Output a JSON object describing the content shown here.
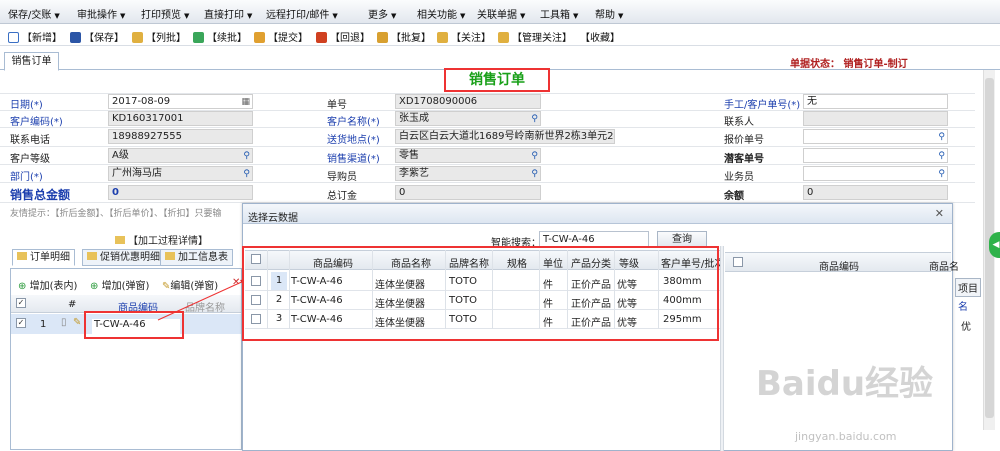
{
  "menubar": [
    {
      "label": "保存/交账"
    },
    {
      "label": "审批操作"
    },
    {
      "label": "打印预览"
    },
    {
      "label": "直接打印"
    },
    {
      "label": "远程打印/邮件"
    },
    {
      "label": "更多"
    },
    {
      "label": "相关功能"
    },
    {
      "label": "关联单据"
    },
    {
      "label": "工具箱"
    },
    {
      "label": "帮助"
    }
  ],
  "toolbar": [
    {
      "label": "【新增】",
      "icon": "new-doc-icon",
      "color": "#3a6fc4"
    },
    {
      "label": "【保存】",
      "icon": "save-icon",
      "color": "#2b55a6"
    },
    {
      "label": "【列批】",
      "icon": "check-icon",
      "color": "#e0b040"
    },
    {
      "label": "【续批】",
      "icon": "continue-icon",
      "color": "#3aa65a"
    },
    {
      "label": "【提交】",
      "icon": "submit-icon",
      "color": "#e0a030"
    },
    {
      "label": "【回退】",
      "icon": "rollback-icon",
      "color": "#d04020"
    },
    {
      "label": "【批复】",
      "icon": "reply-icon",
      "color": "#d8a030"
    },
    {
      "label": "【关注】",
      "icon": "follow-icon",
      "color": "#e0b040"
    },
    {
      "label": "【管理关注】",
      "icon": "manage-follow-icon",
      "color": "#e0b040"
    },
    {
      "label": "【收藏】",
      "icon": "",
      "color": ""
    }
  ],
  "main_tab": "销售订单",
  "status": "单据状态： 销售订单-制订",
  "form_title": "销售订单",
  "fields": {
    "date_label": "日期(*)",
    "date_value": "2017-08-09",
    "order_no_label": "单号",
    "order_no_value": "XD1708090006",
    "manual_no_label": "手工/客户单号(*)",
    "manual_no_value": "无",
    "cust_code_label": "客户编码(*)",
    "cust_code_value": "KD160317001",
    "cust_name_label": "客户名称(*)",
    "cust_name_value": "张玉成",
    "contact_label": "联系人",
    "contact_value": "",
    "phone_label": "联系电话",
    "phone_value": "18988927555",
    "address_label": "送货地点(*)",
    "address_value": "白云区白云大道北1689号岭南新世界2栋3单元2楼02之",
    "quote_label": "报价单号",
    "quote_value": "",
    "level_label": "客户等级",
    "level_value": "A级",
    "channel_label": "销售渠道(*)",
    "channel_value": "零售",
    "potential_label": "潜客单号",
    "potential_value": "",
    "dept_label": "部门(*)",
    "dept_value": "广州海马店",
    "guide_label": "导购员",
    "guide_value": "李紫艺",
    "sales_label": "业务员",
    "sales_value": "",
    "total_label": "销售总金额",
    "total_value": "0",
    "order_total_label": "总订金",
    "order_total_value": "0",
    "balance_label": "余额",
    "balance_value": "0"
  },
  "hint": "友情提示：【折后金额】、【折后单价】、【折扣】只要输",
  "process_btn": "【加工过程详情】",
  "subtabs": [
    "订单明细",
    "促销优惠明细",
    "加工信息表"
  ],
  "left_grid": {
    "buttons": [
      "增加(表内)",
      "增加(弹窗)",
      "编辑(弹窗)"
    ],
    "headers": [
      "#",
      "商品编码",
      "品牌名称"
    ],
    "row": {
      "num": "1",
      "code": "T-CW-A-46"
    }
  },
  "popup": {
    "title": "选择云数据",
    "search_label": "智能搜索：",
    "search_value": "T-CW-A-46",
    "query_btn": "查询",
    "headers": [
      "商品编码",
      "商品名称",
      "品牌名称",
      "规格",
      "单位",
      "产品分类",
      "等级",
      "客户单号/批次"
    ],
    "rows": [
      {
        "num": "1",
        "code": "T-CW-A-46",
        "name": "连体坐便器",
        "brand": "TOTO",
        "spec": "",
        "unit": "件",
        "category": "正价产品",
        "grade": "优等",
        "batch": "380mm"
      },
      {
        "num": "2",
        "code": "T-CW-A-46",
        "name": "连体坐便器",
        "brand": "TOTO",
        "spec": "",
        "unit": "件",
        "category": "正价产品",
        "grade": "优等",
        "batch": "400mm"
      },
      {
        "num": "3",
        "code": "T-CW-A-46",
        "name": "连体坐便器",
        "brand": "TOTO",
        "spec": "",
        "unit": "件",
        "category": "正价产品",
        "grade": "优等",
        "batch": "295mm"
      }
    ],
    "right_headers": [
      "商品编码",
      "商品名"
    ]
  },
  "right_edge": {
    "btn": "项目",
    "col": "名",
    "col2": "优"
  },
  "watermark": "Baidu经验",
  "watermark_url": "jingyan.baidu.com"
}
